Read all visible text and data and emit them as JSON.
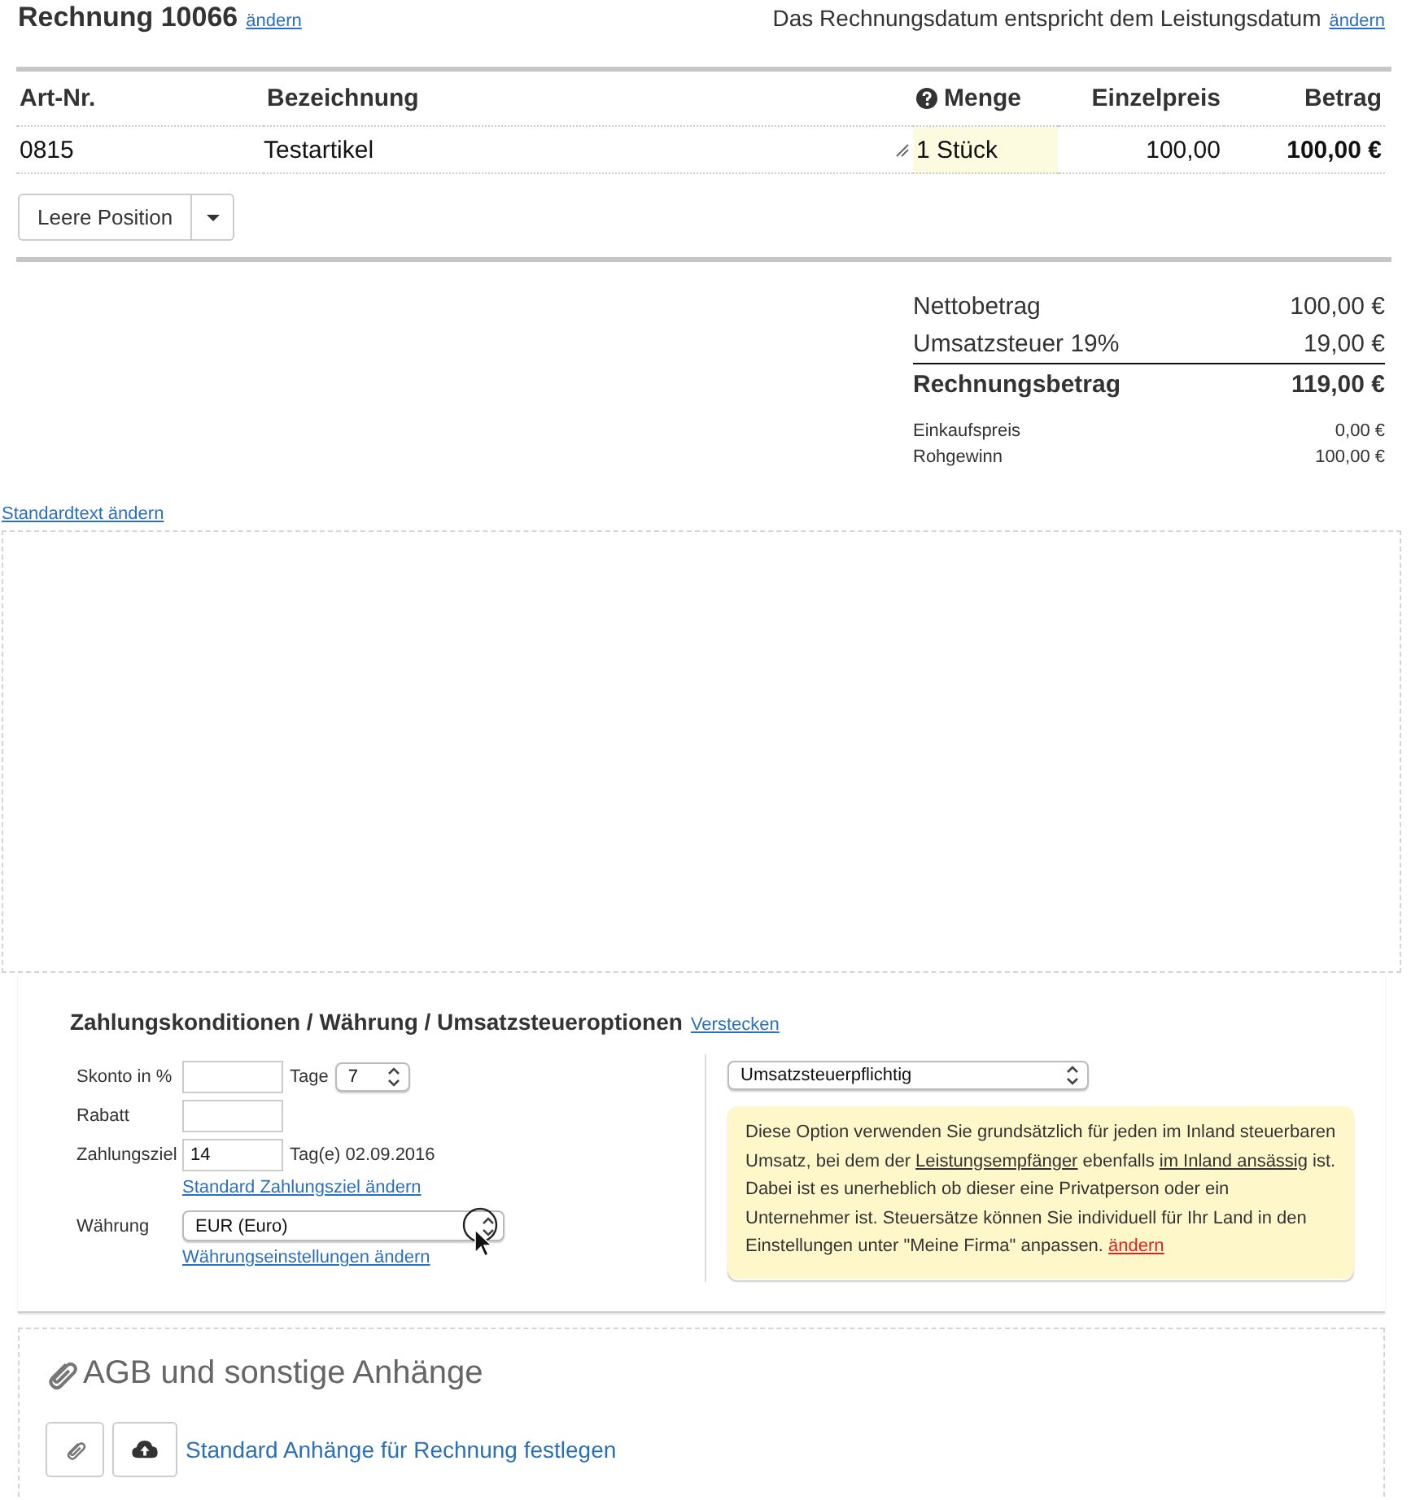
{
  "header": {
    "title": "Rechnung 10066",
    "title_link": "ändern",
    "date_note": "Das Rechnungsdatum entspricht dem Leistungsdatum",
    "date_link": "ändern"
  },
  "positions": {
    "columns": [
      {
        "label": "Art-Nr.",
        "help": false
      },
      {
        "label": "Bezeichnung",
        "help": false
      },
      {
        "label": "Menge",
        "help": true
      },
      {
        "label": "Einzelpreis",
        "help": false
      },
      {
        "label": "Betrag",
        "help": false
      }
    ],
    "rows": [
      {
        "article_no": "0815",
        "description": "Testartikel",
        "quantity": "1 Stück",
        "unit_price": "100,00",
        "amount": "100,00 €"
      }
    ],
    "add_button": "Leere Position"
  },
  "totals": [
    {
      "kind": "main",
      "label": "Nettobetrag",
      "value": "100,00 €"
    },
    {
      "kind": "subtotal",
      "label": "Umsatzsteuer 19%",
      "value": "19,00 €"
    },
    {
      "kind": "total",
      "label": "Rechnungsbetrag",
      "value": "119,00 €"
    },
    {
      "kind": "minor",
      "label": "Einkaufspreis",
      "value": "0,00 €"
    },
    {
      "kind": "minor",
      "label": "Rohgewinn",
      "value": "100,00 €"
    }
  ],
  "standard_text": {
    "link": "Standardtext ändern"
  },
  "payment": {
    "title": "Zahlungskonditionen / Währung / Umsatzsteueroptionen",
    "hide_link": "Verstecken",
    "discount_label": "Skonto in %",
    "days_label": "Tage",
    "days_value": "7",
    "rebate_label": "Rabatt",
    "due_label": "Zahlungsziel",
    "due_value": "14",
    "due_note": "Tag(e) 02.09.2016",
    "due_link": "Standard Zahlungsziel ändern",
    "currency_label": "Währung",
    "currency_value": "EUR (Euro)",
    "currency_link": "Währungseinstellungen ändern",
    "tax_option": "Umsatzsteuerpflichtig",
    "tax_info": [
      {
        "kind": "text",
        "text": "Diese Option verwenden Sie grundsätzlich für jeden im Inland steuerbaren Umsatz, bei dem der "
      },
      {
        "kind": "term",
        "text": "Leistungsempfänger"
      },
      {
        "kind": "text",
        "text": " ebenfalls "
      },
      {
        "kind": "term",
        "text": "im Inland ansässig"
      },
      {
        "kind": "text",
        "text": " ist. Dabei ist es unerheblich ob dieser eine Privatperson oder ein Unternehmer ist. Steuersätze können Sie individuell für Ihr Land in den Einstellungen unter \"Meine Firma\" anpassen. "
      },
      {
        "kind": "link",
        "text": "ändern"
      }
    ]
  },
  "attachments": {
    "title": "AGB und sonstige Anhänge",
    "link": "Standard Anhänge für Rechnung festlegen"
  }
}
